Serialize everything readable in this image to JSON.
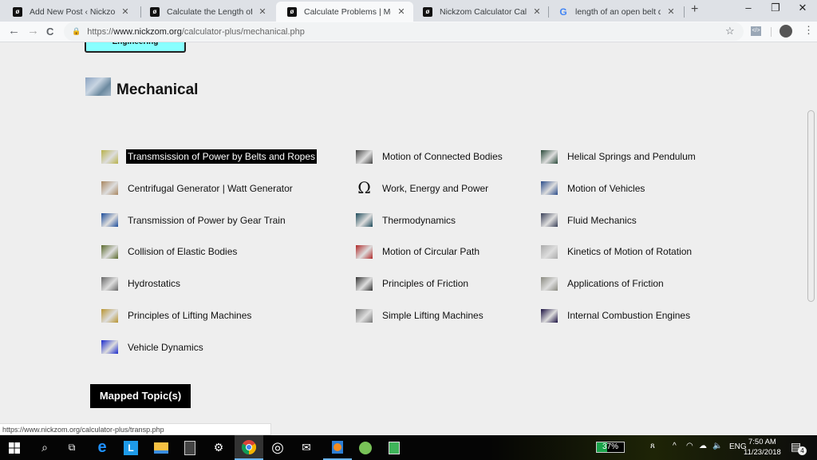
{
  "browser": {
    "tabs": [
      {
        "title": "Add New Post ‹ Nickzom Blog",
        "favicon": "nickzom-icon",
        "active": false
      },
      {
        "title": "Calculate the Length of an Open",
        "favicon": "nickzom-icon",
        "active": false
      },
      {
        "title": "Calculate Problems | Mechanical",
        "favicon": "nickzom-icon",
        "active": true
      },
      {
        "title": "Nickzom Calculator Calculates",
        "favicon": "nickzom-icon",
        "active": false
      },
      {
        "title": "length of an open belt drive - G",
        "favicon": "google-icon",
        "active": false
      }
    ],
    "new_tab": "+",
    "window_controls": {
      "minimize": "–",
      "restore": "❐",
      "close": "✕"
    },
    "nav": {
      "back": "←",
      "forward": "→",
      "reload": "C"
    },
    "url": {
      "scheme": "https://",
      "host": "www.nickzom.org",
      "path": "/calculator-plus/mechanical.php"
    },
    "ext_label": "</>",
    "status_url": "https://www.nickzom.org/calculator-plus/transp.php"
  },
  "page": {
    "parent_button": "Engineering",
    "section_title": "Mechanical",
    "columns": [
      [
        {
          "label": "Transmsission of Power by Belts and Ropes",
          "highlighted": true,
          "color": "#b8b24a"
        },
        {
          "label": "Centrifugal Generator | Watt Generator",
          "color": "#a88660"
        },
        {
          "label": "Transmission of Power by Gear Train",
          "color": "#1c4c9a"
        },
        {
          "label": "Collision of Elastic Bodies",
          "color": "#5a6a2c"
        },
        {
          "label": "Hydrostatics",
          "color": "#666666"
        },
        {
          "label": "Principles of Lifting Machines",
          "color": "#b89430"
        },
        {
          "label": "Vehicle Dynamics",
          "color": "#1a2acc"
        }
      ],
      [
        {
          "label": "Motion of Connected Bodies",
          "color": "#444444"
        },
        {
          "label": "Work, Energy and Power",
          "glyph": "Ω",
          "color": "#000000"
        },
        {
          "label": "Thermodynamics",
          "color": "#1c4a5a"
        },
        {
          "label": "Motion of Circular Path",
          "color": "#b02828"
        },
        {
          "label": "Principles of Friction",
          "color": "#333333"
        },
        {
          "label": "Simple Lifting Machines",
          "color": "#777777"
        }
      ],
      [
        {
          "label": "Helical Springs and Pendulum",
          "color": "#2a4a3a"
        },
        {
          "label": "Motion of Vehicles",
          "color": "#2a4c8a"
        },
        {
          "label": "Fluid Mechanics",
          "color": "#3a4058"
        },
        {
          "label": "Kinetics of Motion of Rotation",
          "color": "#aaaaaa"
        },
        {
          "label": "Applications of Friction",
          "color": "#8a8a80"
        },
        {
          "label": "Internal Combustion Engines",
          "color": "#1a1040"
        }
      ]
    ],
    "mapped_topics": "Mapped Topic(s)"
  },
  "taskbar": {
    "apps": [
      "windows-start-icon",
      "search-icon",
      "task-view-icon",
      "edge-icon",
      "l-app-icon",
      "file-explorer-icon",
      "calculator-icon",
      "settings-icon",
      "chrome-icon",
      "groove-icon",
      "mail-icon",
      "media-player-icon",
      "android-studio-icon",
      "notepad-icon"
    ],
    "battery": "37%",
    "battery_level": 0.37,
    "language": "ENG",
    "time": "7:50 AM",
    "date": "11/23/2018",
    "notifications": "4"
  }
}
